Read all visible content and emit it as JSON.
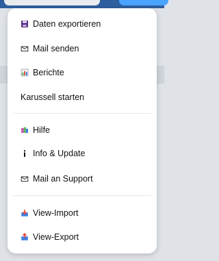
{
  "menu": {
    "items": [
      {
        "label": "Daten exportieren",
        "icon": "floppy-disk-icon"
      },
      {
        "label": "Mail senden",
        "icon": "envelope-icon"
      },
      {
        "label": "Berichte",
        "icon": "bar-chart-icon"
      },
      {
        "label": "Karussell starten",
        "icon": ""
      },
      {
        "label": "Hilfe",
        "icon": "help-books-icon"
      },
      {
        "label": "Info & Update",
        "icon": "info-icon"
      },
      {
        "label": "Mail an Support",
        "icon": "envelope-icon"
      },
      {
        "label": "View-Import",
        "icon": "import-icon"
      },
      {
        "label": "View-Export",
        "icon": "export-icon"
      }
    ]
  },
  "colors": {
    "accent_blue": "#2f5e9e",
    "menu_bg": "#ffffff",
    "divider": "#e6e6e6"
  }
}
